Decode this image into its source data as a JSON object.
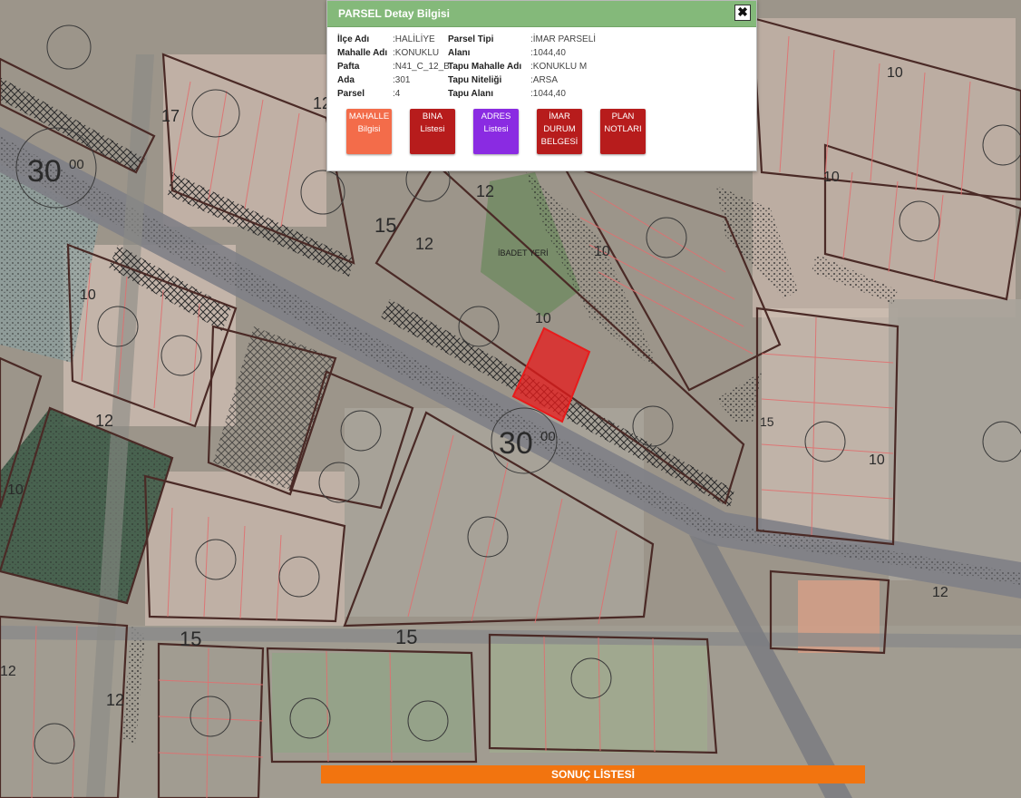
{
  "panel": {
    "title": "PARSEL Detay Bilgisi",
    "close_glyph": "✖",
    "close_icon": "close-icon",
    "left_rows": [
      {
        "label": "İlçe Adı",
        "value": ":HALİLİYE"
      },
      {
        "label": "Mahalle Adı",
        "value": ":KONUKLU"
      },
      {
        "label": "Pafta",
        "value": ":N41_C_12_B"
      },
      {
        "label": "Ada",
        "value": ":301"
      },
      {
        "label": "Parsel",
        "value": ":4"
      }
    ],
    "right_rows": [
      {
        "label": "Parsel Tipi",
        "value": ":İMAR PARSELİ"
      },
      {
        "label": "Alanı",
        "value": ":1044,40"
      },
      {
        "label": "Tapu Mahalle Adı",
        "value": ":KONUKLU M"
      },
      {
        "label": "Tapu Niteliği",
        "value": ":ARSA"
      },
      {
        "label": "Tapu Alanı",
        "value": ":1044,40"
      }
    ],
    "buttons": [
      {
        "label": "MAHALLE\nBilgisi",
        "color": "#f36c4a"
      },
      {
        "label": "BINA\nListesi",
        "color": "#b71c1c"
      },
      {
        "label": "ADRES\nListesi",
        "color": "#8a2be2"
      },
      {
        "label": "İMAR\nDURUM\nBELGESİ",
        "color": "#b71c1c"
      },
      {
        "label": "PLAN\nNOTLARI",
        "color": "#b71c1c"
      }
    ]
  },
  "map": {
    "road_labels": [
      "30",
      "30",
      "15",
      "15",
      "12",
      "12",
      "10",
      "10",
      "10",
      "17",
      "12",
      "12",
      "12",
      "10",
      "10",
      "10",
      "15",
      "12",
      "12",
      "15",
      "10"
    ],
    "road_label_sup": "00",
    "area_label": "İBADET YERİ",
    "highlight_color": "#e81b1b",
    "parcel_line_color": "#e07070",
    "block_line_color": "#4a2a26"
  },
  "results_bar": {
    "label": "SONUÇ LİSTESİ",
    "color": "#f2740f"
  }
}
